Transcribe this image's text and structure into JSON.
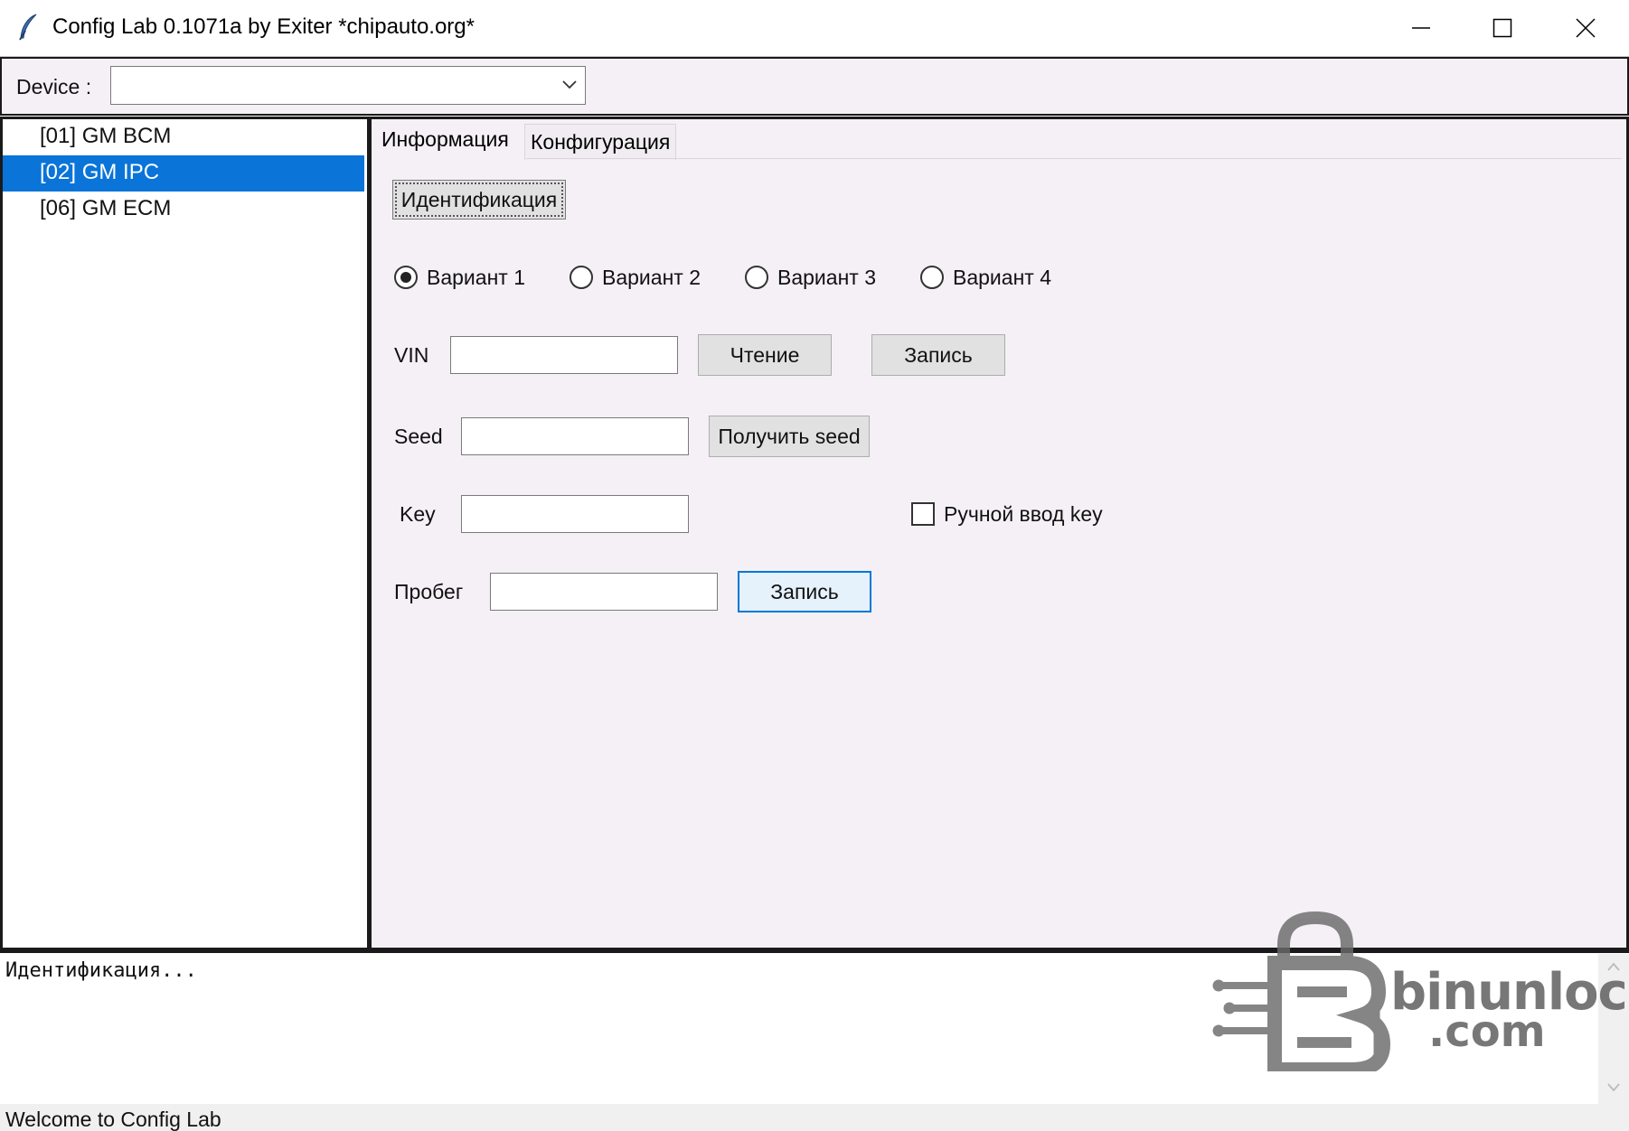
{
  "window": {
    "title": "Config Lab 0.1071a by Exiter *chipauto.org*",
    "icon": "feather-icon",
    "controls": [
      "minimize",
      "maximize",
      "close"
    ]
  },
  "device_bar": {
    "label": "Device :",
    "selected_value": ""
  },
  "device_list": {
    "items": [
      {
        "label": "[01] GM BCM",
        "selected": false
      },
      {
        "label": "[02] GM IPC",
        "selected": true
      },
      {
        "label": "[06] GM ECM",
        "selected": false
      }
    ]
  },
  "tabs": [
    {
      "label": "Информация",
      "active": true
    },
    {
      "label": "Конфигурация",
      "active": false
    }
  ],
  "info_tab": {
    "identify_button": "Идентификация",
    "variants": [
      {
        "label": "Вариант 1",
        "checked": true
      },
      {
        "label": "Вариант 2",
        "checked": false
      },
      {
        "label": "Вариант 3",
        "checked": false
      },
      {
        "label": "Вариант 4",
        "checked": false
      }
    ],
    "vin": {
      "label": "VIN",
      "value": "",
      "read_button": "Чтение",
      "write_button": "Запись"
    },
    "seed": {
      "label": "Seed",
      "value": "",
      "get_button": "Получить seed"
    },
    "key": {
      "label": "Key",
      "value": "",
      "manual_checkbox_label": "Ручной ввод key",
      "manual_checked": false
    },
    "mileage": {
      "label": "Пробег",
      "value": "",
      "write_button": "Запись"
    }
  },
  "log": {
    "text": "Идентификация..."
  },
  "watermark": {
    "text": "binunlock",
    "subtext": ".com"
  },
  "status": {
    "text": "Welcome to Config Lab"
  }
}
